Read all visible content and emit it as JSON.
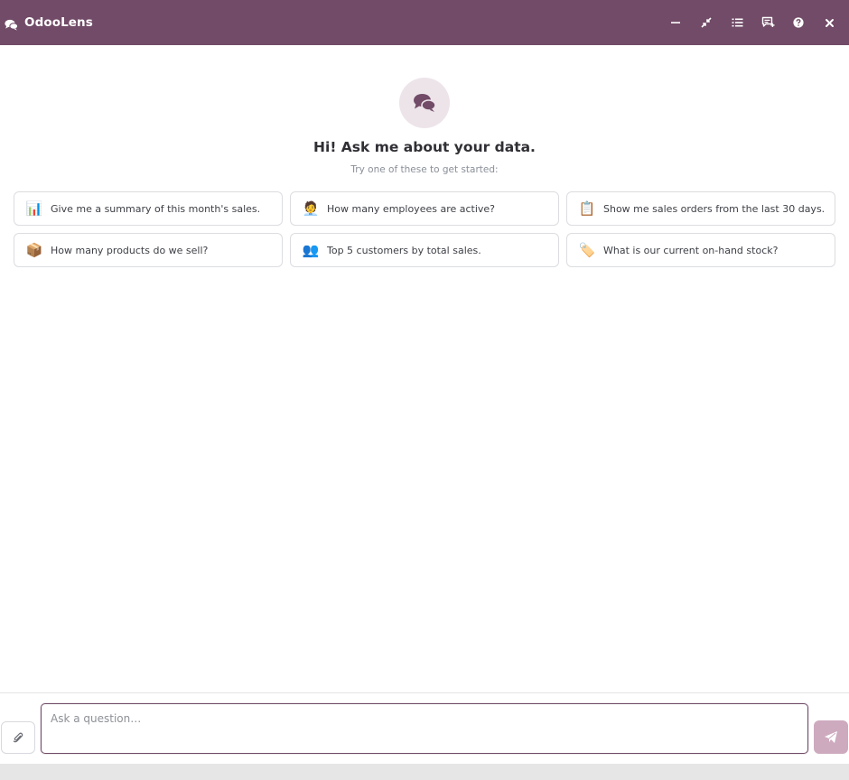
{
  "header": {
    "title": "OdooLens",
    "icons": {
      "brand": "comments-icon",
      "minimize": "minimize-icon",
      "restore": "compress-icon",
      "history": "list-icon",
      "new_chat": "comment-plus-icon",
      "help": "question-circle-icon",
      "close": "close-icon"
    },
    "bg_color": "#714b67"
  },
  "hero": {
    "icon": "comments-icon",
    "title": "Hi! Ask me about your data.",
    "subtitle": "Try one of these to get started:"
  },
  "suggestions": [
    {
      "emoji": "📊",
      "text": "Give me a summary of this month's sales."
    },
    {
      "emoji": "🧑‍💼",
      "text": "How many employees are active?"
    },
    {
      "emoji": "📋",
      "text": "Show me sales orders from the last 30 days."
    },
    {
      "emoji": "📦",
      "text": "How many products do we sell?"
    },
    {
      "emoji": "👥",
      "text": "Top 5 customers by total sales."
    },
    {
      "emoji": "🏷️",
      "text": "What is our current on-hand stock?"
    }
  ],
  "composer": {
    "placeholder": "Ask a question…",
    "value": "",
    "attach_icon": "paperclip-icon",
    "send_icon": "paper-plane-icon",
    "send_color": "#ceaabf"
  }
}
